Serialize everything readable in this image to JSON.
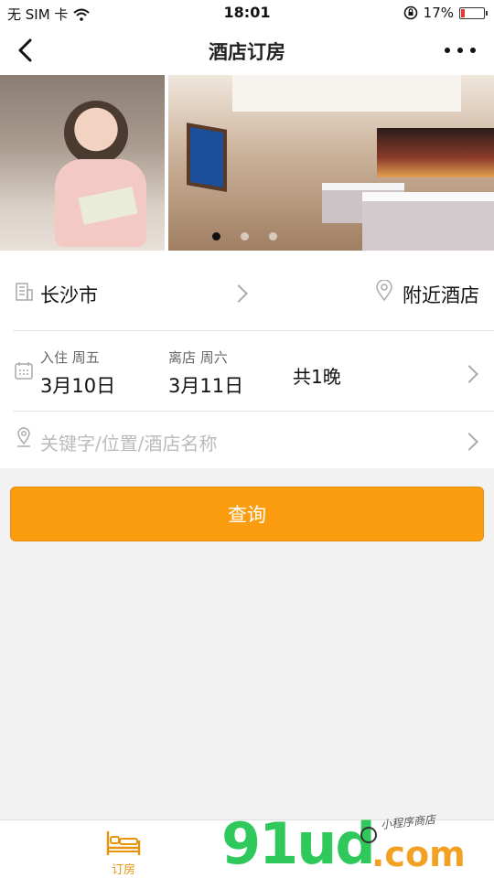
{
  "status_bar": {
    "carrier": "无 SIM 卡",
    "time": "18:01",
    "battery": "17%",
    "battery_level": 0.17
  },
  "nav": {
    "title": "酒店订房"
  },
  "banner": {
    "active_index": 0,
    "slide_count": 3
  },
  "location": {
    "city": "长沙市",
    "nearby_label": "附近酒店"
  },
  "dates": {
    "checkin_label": "入住 周五",
    "checkin_date": "3月10日",
    "checkout_label": "离店 周六",
    "checkout_date": "3月11日",
    "nights": "共1晚"
  },
  "search": {
    "placeholder": "关键字/位置/酒店名称"
  },
  "query_button": "查询",
  "tab_bar": {
    "items": [
      {
        "label": "订房",
        "icon": "bed-icon",
        "active": true
      }
    ]
  },
  "watermark": {
    "brand": "91ud",
    "suffix": ".com",
    "tagline": "小程序商店"
  },
  "colors": {
    "accent": "#fb9d0e",
    "tab_active": "#e8940a",
    "watermark_green": "#2ec95a",
    "watermark_orange": "#f2a125"
  }
}
